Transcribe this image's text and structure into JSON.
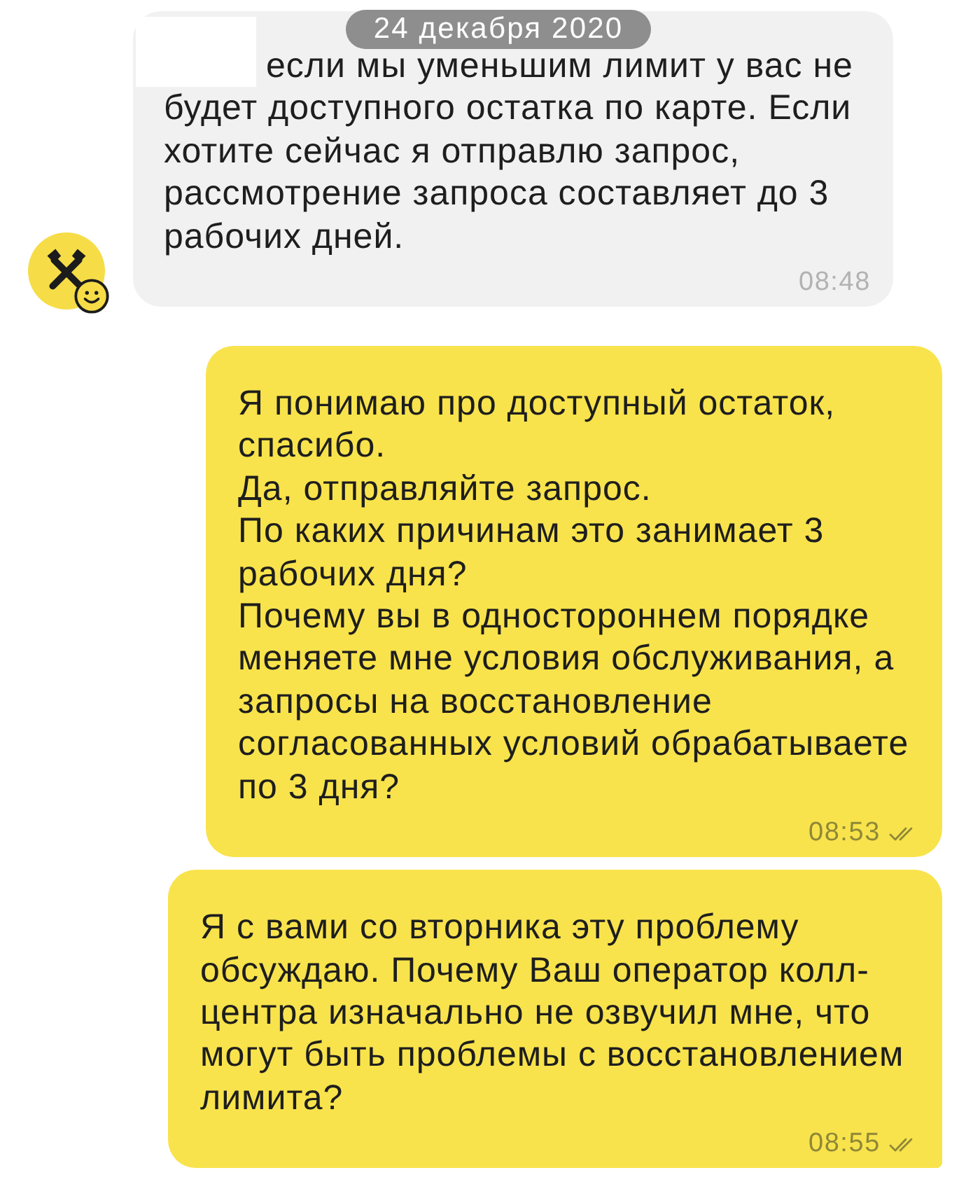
{
  "date_pill": "24 декабря 2020",
  "messages": [
    {
      "kind": "incoming",
      "text": "если мы уменьшим лимит у вас не\nбудет доступного остатка по карте. Если\nхотите сейчас я отправлю запрос,\nрассмотрение запроса составляет до 3\nрабочих дней.",
      "time": "08:48"
    },
    {
      "kind": "outgoing",
      "text": "Я понимаю про доступный остаток,\nспасибо.\nДа, отправляйте запрос.\nПо каких причинам это занимает 3\nрабочих дня?\nПочему вы в одностороннем порядке\nменяете мне условия обслуживания, а\nзапросы на восстановление\nсогласованных условий обрабатываете\nпо 3 дня?",
      "time": "08:53",
      "read": true
    },
    {
      "kind": "outgoing",
      "text": "Я с вами со вторника эту проблему\nобсуждаю. Почему Ваш оператор колл-\nцентра изначально не озвучил мне, что\nмогут быть проблемы с восстановлением\nлимита?",
      "time": "08:55",
      "read": true
    }
  ]
}
